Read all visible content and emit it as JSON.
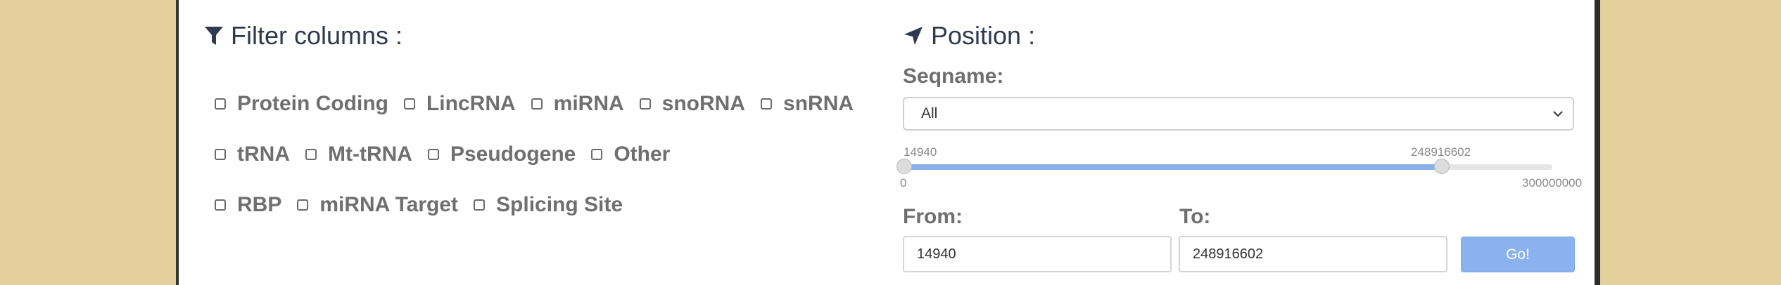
{
  "filter": {
    "title": "Filter columns :",
    "rows": [
      [
        "Protein Coding",
        "LincRNA",
        "miRNA",
        "snoRNA",
        "snRNA"
      ],
      [
        "tRNA",
        "Mt-tRNA",
        "Pseudogene",
        "Other"
      ],
      [
        "RBP",
        "miRNA Target",
        "Splicing Site"
      ]
    ]
  },
  "position": {
    "title": "Position :",
    "seqname_label": "Seqname:",
    "seqname_value": "All",
    "slider": {
      "low_value": "14940",
      "high_value": "248916602",
      "min_label": "0",
      "max_label": "300000000",
      "low_fraction": 4.98e-05,
      "high_fraction": 0.8297
    },
    "from_label": "From:",
    "to_label": "To:",
    "from_value": "14940",
    "to_value": "248916602",
    "go_label": "Go!"
  },
  "colors": {
    "background": "#e3d09a",
    "accent": "#8ab2ee",
    "heading": "#2f3a4f",
    "label": "#6f6f6f"
  }
}
